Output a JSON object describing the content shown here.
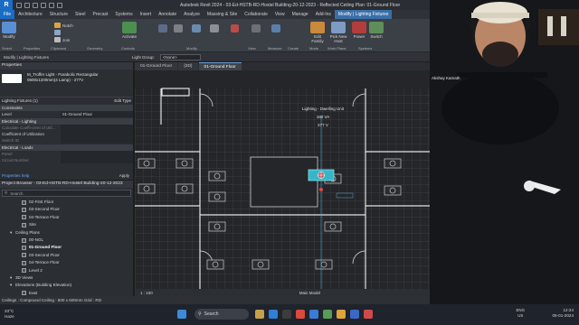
{
  "window": {
    "title": "Autodesk Revit 2024 - 03-Ed-HSTB-RD-Hostel Building-20-12-2023 - Reflected Ceiling Plan: 01-Ground Floor",
    "logo": "R"
  },
  "ribbon_tabs": [
    "File",
    "Architecture",
    "Structure",
    "Steel",
    "Precast",
    "Systems",
    "Insert",
    "Annotate",
    "Analyze",
    "Massing & Site",
    "Collaborate",
    "View",
    "Manage",
    "Add-Ins",
    "Modify | Lighting Fixtures"
  ],
  "ribbon": {
    "modify": "Modify",
    "notch": "Notch",
    "join": "Join",
    "activate": "Activate",
    "edit_family": "Edit Family",
    "pick_new_host": "Pick New Host",
    "power": "Power",
    "switch": "Switch",
    "groups": [
      "Select",
      "Properties",
      "Clipboard",
      "Geometry",
      "Controls",
      "Modify",
      "View",
      "Measure",
      "Create",
      "Mode",
      "Work Plane",
      "Systems"
    ]
  },
  "option_bar": {
    "context": "Modify | Lighting Fixtures",
    "light_group_label": "Light Group:",
    "light_group_value": "<None>"
  },
  "properties": {
    "header": "Properties",
    "type_name_1": "M_Troffer Light - Parabolic Rectangular",
    "type_name_2": "0600x1200mm(4 Lamp) - 277V",
    "instance": "Lighting Fixtures (1)",
    "edit_type": "Edit Type",
    "sections": {
      "constraints": "Constraints",
      "electrical_lighting": "Electrical - Lighting",
      "electrical_loads": "Electrical - Loads"
    },
    "level_label": "Level",
    "level_value": "01-Ground Floor",
    "calc_cu": "Calculate Coeffi-cient of Util...",
    "coeff": "Coefficient of Utilization",
    "switch_id": "Switch ID",
    "panel": "Panel",
    "circuit": "Circuit Number",
    "help": "Properties help",
    "apply": "Apply"
  },
  "project_browser": {
    "header": "Project Browser - 03-Ed-HSTB-RD-Hostel Building-20-12-2023",
    "search_placeholder": "Search",
    "nodes": [
      {
        "label": "02-First Floor",
        "indent": 2,
        "bold": false,
        "box": true
      },
      {
        "label": "03-Second Floor",
        "indent": 2,
        "bold": false,
        "box": true
      },
      {
        "label": "04-Terrace Floor",
        "indent": 2,
        "bold": false,
        "box": true
      },
      {
        "label": "Site",
        "indent": 2,
        "bold": false,
        "box": true
      },
      {
        "label": "Ceiling Plans",
        "indent": 1,
        "bold": false,
        "box": false
      },
      {
        "label": "00-NGL",
        "indent": 2,
        "bold": false,
        "box": true
      },
      {
        "label": "01-Ground Floor",
        "indent": 2,
        "bold": true,
        "box": true
      },
      {
        "label": "03-Second Floor",
        "indent": 2,
        "bold": false,
        "box": true
      },
      {
        "label": "04-Terrace Floor",
        "indent": 2,
        "bold": false,
        "box": true
      },
      {
        "label": "Level 2",
        "indent": 2,
        "bold": false,
        "box": true
      },
      {
        "label": "3D Views",
        "indent": 1,
        "bold": false,
        "box": false
      },
      {
        "label": "Elevations (Building Elevation)",
        "indent": 1,
        "bold": false,
        "box": false
      },
      {
        "label": "East",
        "indent": 2,
        "bold": false,
        "box": true
      }
    ]
  },
  "doc_tabs": [
    {
      "label": "01-Ground Floor",
      "active": false
    },
    {
      "label": "{3D}",
      "active": false
    },
    {
      "label": "01-Ground Floor",
      "active": true
    }
  ],
  "canvas": {
    "tag_name": "Lighting - Dwelling Unit",
    "tag_va": "180 VA",
    "tag_volt": "277 V"
  },
  "view_bar": {
    "scale": "1 : 100",
    "main_model": "Main Model"
  },
  "status": {
    "text": "Ceilings : Compound Ceiling : 600 x 600mm Grid : RD"
  },
  "taskbar": {
    "temp": "23°C",
    "weather": "Haze",
    "search": "Search",
    "lang1": "ENG",
    "lang2": "US",
    "time": "12:24",
    "date": "05-01-2024"
  },
  "webcam": {
    "name": "Akshay Kamath"
  },
  "colors": {
    "file_tab": "#1a6cc4",
    "context_tab": "#3a6ea8",
    "selection": "#36b6c9",
    "wall_line": "#d0d0d0"
  }
}
